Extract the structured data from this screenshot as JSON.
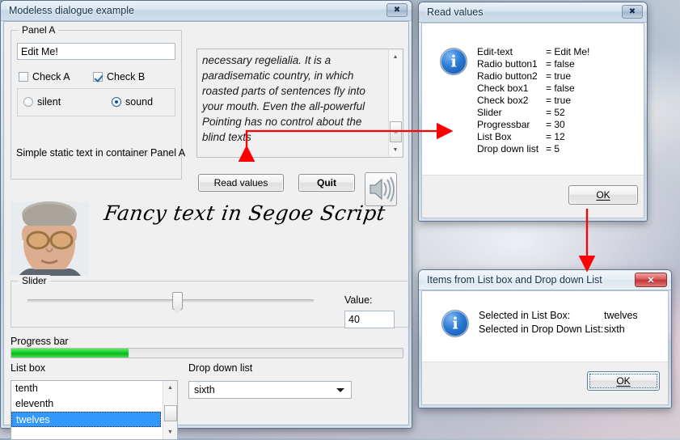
{
  "main_window": {
    "title": "Modeless dialogue example",
    "close_glyph": "✖",
    "panel_a": {
      "legend": "Panel A",
      "edit_value": "Edit Me!",
      "edit_placeholder": "Edit Me!",
      "check_a_label": "Check A",
      "check_b_label": "Check B",
      "check_a_checked": false,
      "check_b_checked": true,
      "radio_silent_label": "silent",
      "radio_sound_label": "sound",
      "radio_selected": "sound",
      "static_text": "Simple static text in container Panel A"
    },
    "memo": {
      "text": "necessary regelialia. It is a paradisematic country, in which roasted parts of sentences fly into your mouth.  Even the all-powerful Pointing has no control about the blind texts",
      "scroll_up_glyph": "▲",
      "scroll_down_glyph": "▼",
      "thumb_glyph": "≡"
    },
    "buttons": {
      "read_values": "Read values",
      "quit": "Quit",
      "speaker_icon": "speaker-icon"
    },
    "fancy_text": "Fancy text in Segoe Script",
    "photo_alt": "portrait-photo",
    "slider": {
      "legend": "Slider",
      "value_label": "Value:",
      "value": "40",
      "position_percent": 52
    },
    "progress": {
      "label": "Progress bar",
      "value_percent": 30
    },
    "listbox": {
      "label": "List box",
      "items": [
        "tenth",
        "eleventh",
        "twelves"
      ],
      "selected": "twelves",
      "scroll_up_glyph": "▲",
      "scroll_down_glyph": "▼"
    },
    "combo": {
      "label": "Drop down list",
      "selected": "sixth",
      "arrow_icon": "chevron-down-icon"
    }
  },
  "read_dialog": {
    "title": "Read values",
    "close_glyph": "✖",
    "icon": "info-icon",
    "rows": [
      {
        "key": "Edit-text",
        "value": "= Edit Me!"
      },
      {
        "key": "Radio button1",
        "value": "= false"
      },
      {
        "key": "Radio button2",
        "value": "= true"
      },
      {
        "key": "Check box1",
        "value": "= false"
      },
      {
        "key": "Check box2",
        "value": "= true"
      },
      {
        "key": "Slider",
        "value": "= 52"
      },
      {
        "key": "Progressbar",
        "value": "= 30"
      },
      {
        "key": "List Box",
        "value": "= 12"
      },
      {
        "key": "Drop down list",
        "value": "= 5"
      }
    ],
    "ok_label": "OK"
  },
  "items_dialog": {
    "title": "Items from List box and Drop down List",
    "close_glyph": "✕",
    "icon": "info-icon",
    "rows": [
      {
        "key": "Selected in List Box:",
        "value": "twelves"
      },
      {
        "key": "Selected in Drop Down List:",
        "value": "sixth"
      }
    ],
    "ok_label": "OK"
  },
  "annotations": {
    "arrow_color": "#fe0000",
    "arrow_1": "read-values-to-read-dialog",
    "arrow_2": "read-dialog-ok-to-items-dialog"
  }
}
